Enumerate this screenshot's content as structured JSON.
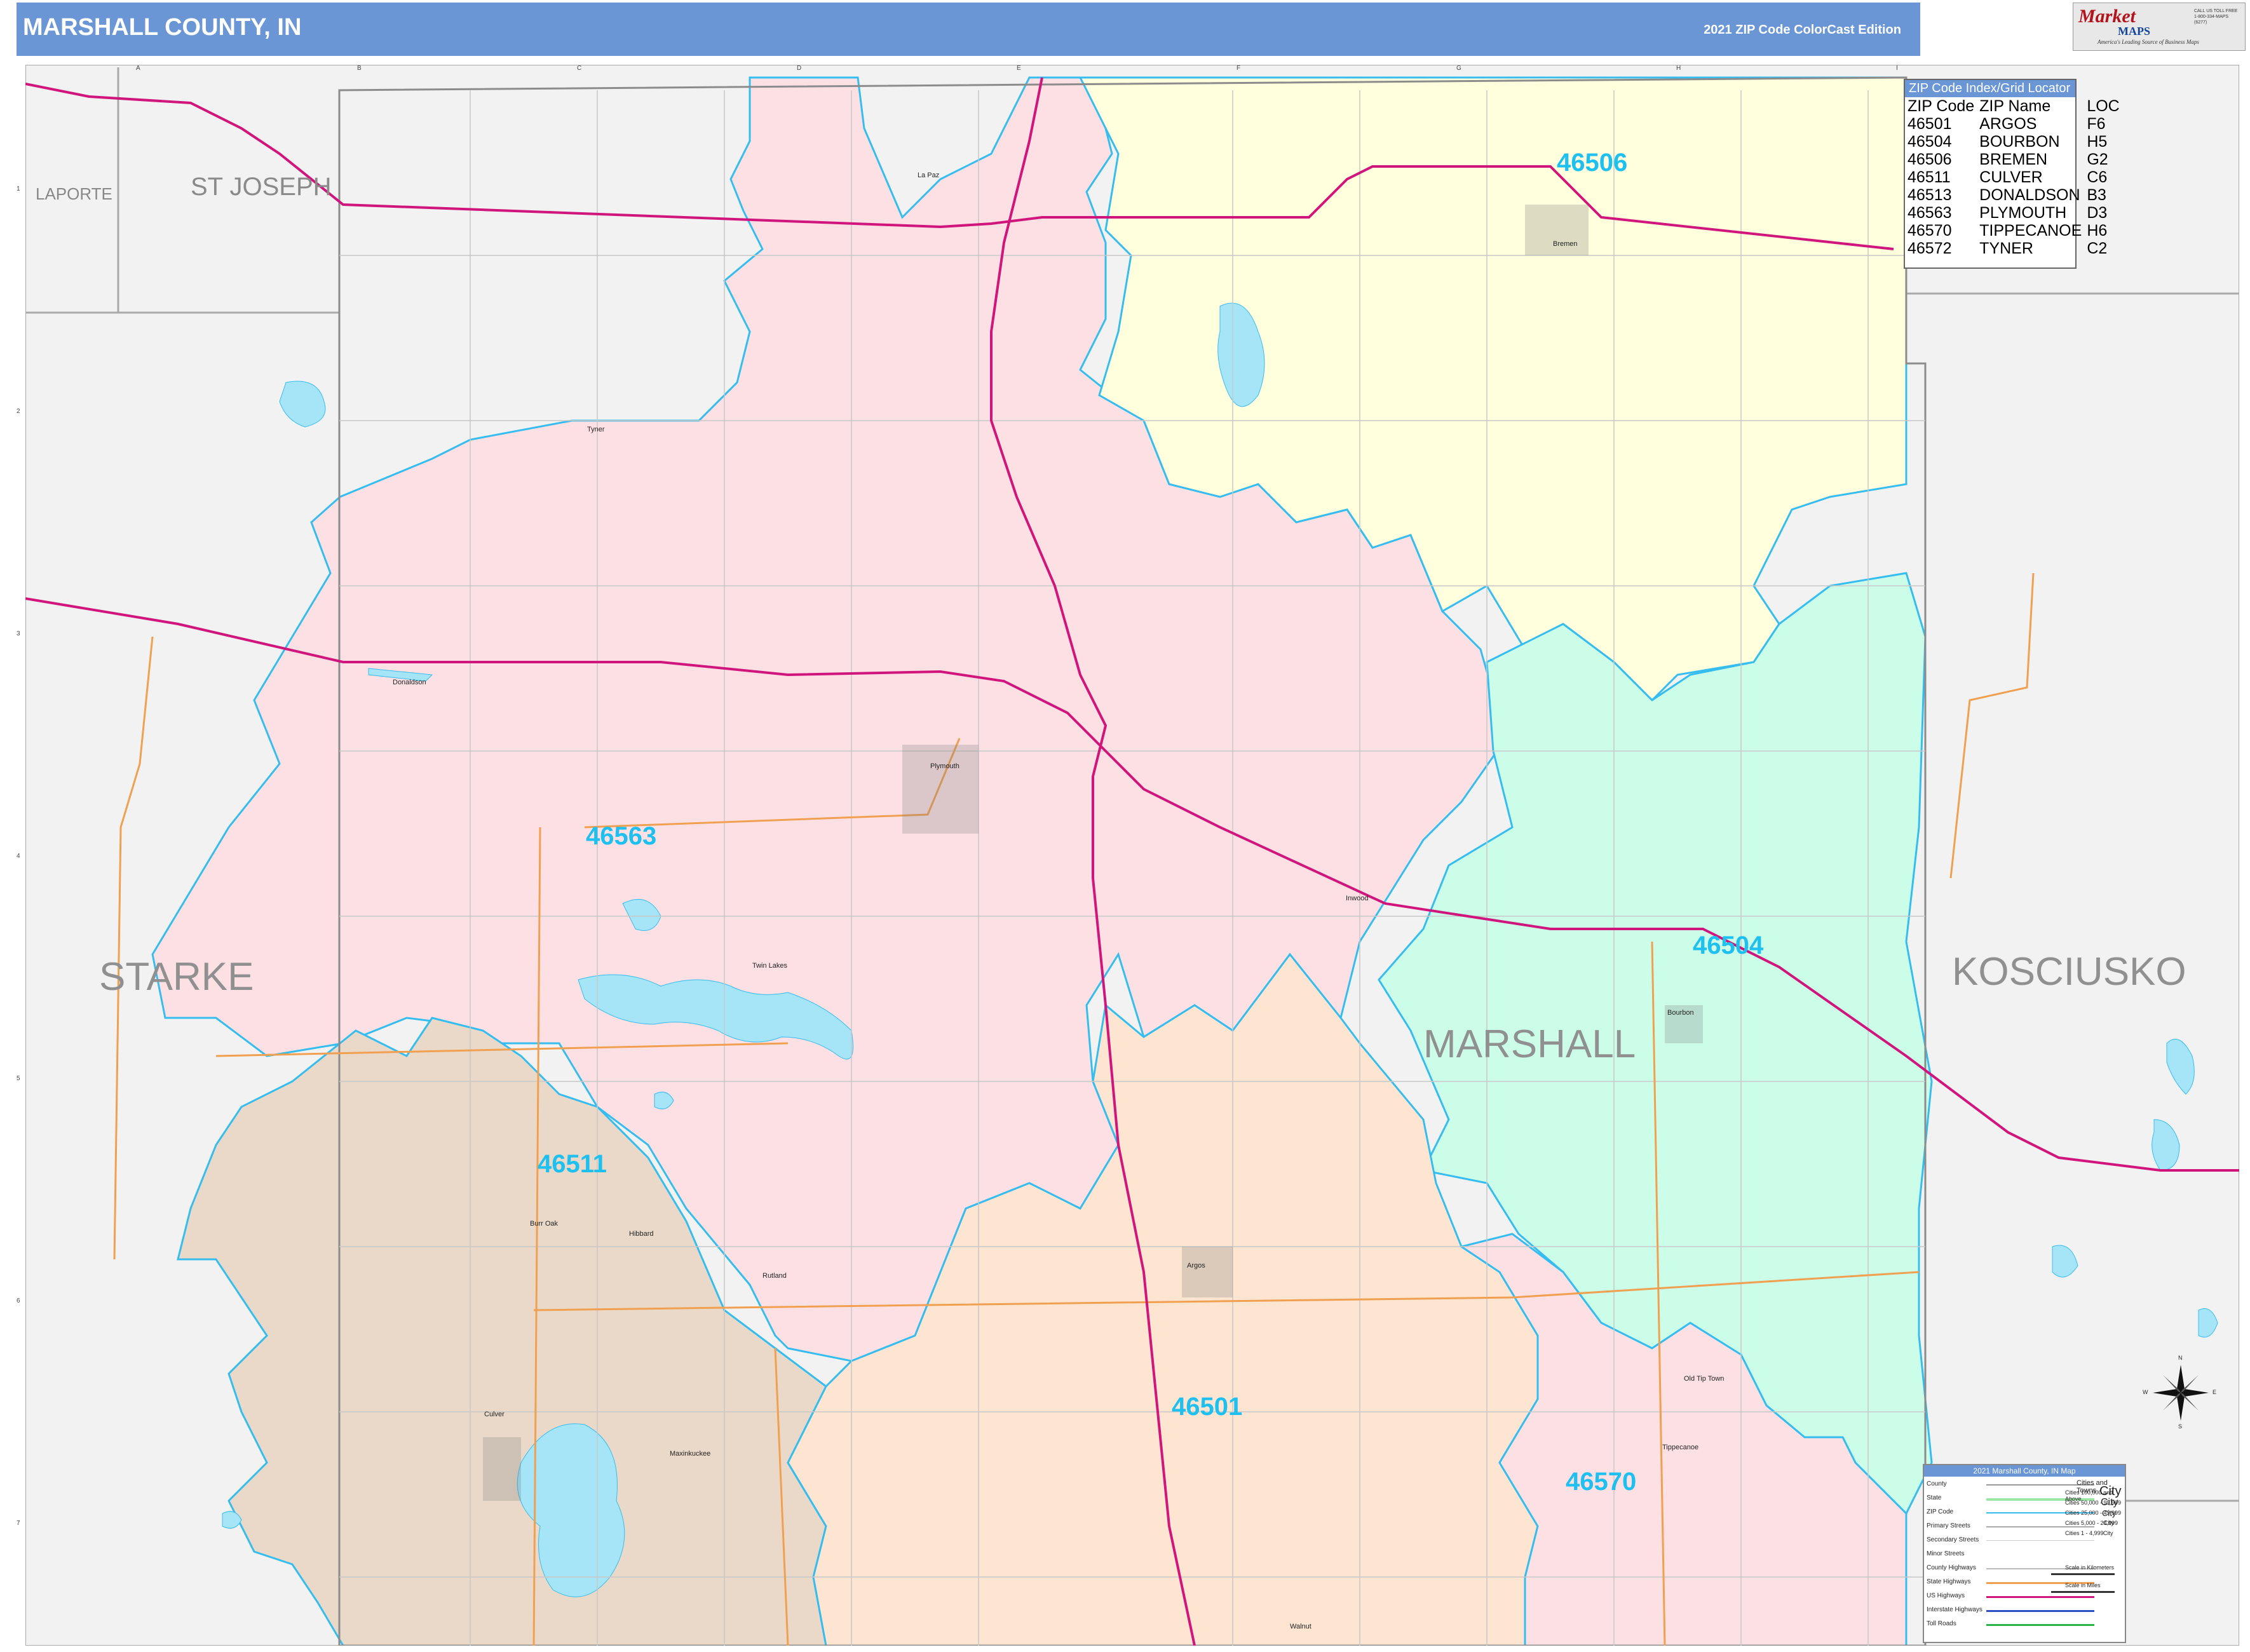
{
  "header": {
    "title": "MARSHALL COUNTY, IN",
    "edition": "2021 ZIP Code ColorCast Edition"
  },
  "logo": {
    "mark": "Market",
    "brand": "MAPS",
    "slogan": "America's Leading Source of Business Maps",
    "phone": "CALL US TOLL FREE 1-800-334-MAPS (6277)"
  },
  "zip_index": {
    "title": "ZIP Code Index/Grid Locator",
    "columns": [
      "ZIP Code",
      "ZIP Name",
      "LOC"
    ],
    "rows": [
      [
        "46501",
        "ARGOS",
        "F6"
      ],
      [
        "46504",
        "BOURBON",
        "H5"
      ],
      [
        "46506",
        "BREMEN",
        "G2"
      ],
      [
        "46511",
        "CULVER",
        "C6"
      ],
      [
        "46513",
        "DONALDSON",
        "B3"
      ],
      [
        "46563",
        "PLYMOUTH",
        "D3"
      ],
      [
        "46570",
        "TIPPECANOE",
        "H6"
      ],
      [
        "46572",
        "TYNER",
        "C2"
      ]
    ]
  },
  "zip_labels": {
    "z46506": "46506",
    "z46563": "46563",
    "z46504": "46504",
    "z46511": "46511",
    "z46501": "46501",
    "z46570": "46570"
  },
  "counties": {
    "starke": "STARKE",
    "marshall": "MARSHALL",
    "kosciusko": "KOSCIUSKO",
    "st_joseph": "ST JOSEPH",
    "laporte": "LAPORTE"
  },
  "towns": {
    "la_paz": "La Paz",
    "bremen": "Bremen",
    "tyner": "Tyner",
    "donaldson": "Donaldson",
    "plymouth": "Plymouth",
    "twin_lakes": "Twin Lakes",
    "inwood": "Inwood",
    "bourbon": "Bourbon",
    "burr_oak": "Burr Oak",
    "hibbard": "Hibbard",
    "rutland": "Rutland",
    "culver": "Culver",
    "maxinkuckee": "Maxinkuckee",
    "old_tip_town": "Old Tip Town",
    "tippecanoe": "Tippecanoe",
    "walnut": "Walnut",
    "argos": "Argos"
  },
  "grid": {
    "columns": [
      "A",
      "B",
      "C",
      "D",
      "E",
      "F",
      "G",
      "H",
      "I"
    ],
    "rows": [
      "1",
      "2",
      "3",
      "4",
      "5",
      "6",
      "7"
    ]
  },
  "map_legend": {
    "title": "2021 Marshall County, IN Map",
    "items": [
      "County",
      "State",
      "ZIP Code",
      "Primary Streets",
      "Secondary Streets",
      "Minor Streets",
      "County Highways",
      "State Highways",
      "US Highways",
      "Interstate Highways",
      "Toll Roads"
    ],
    "cities_title": "Cities and Towns",
    "city_sizes": [
      "Cities 100,000 and Above",
      "Cities 50,000 - 99,999",
      "Cities 25,000 - 49,999",
      "Cities 5,000 - 24,999",
      "Cities 1 - 4,999"
    ],
    "city_samples": [
      "City",
      "City",
      "City",
      "City",
      "City"
    ],
    "scale_km": "Scale in Kilometers",
    "scale_mi": "Scale in Miles"
  },
  "compass": {
    "n": "N",
    "s": "S",
    "e": "E",
    "w": "W"
  },
  "colors": {
    "header": "#6a96d6",
    "z46563": "#fde0e4",
    "z46506": "#fffedd",
    "z46504": "#ccfde8",
    "z46511": "#ead9c8",
    "z46501": "#fde5d1",
    "z46570": "#fde0e4",
    "zip_boundary": "#35bdf0",
    "us_highway": "#d0157c",
    "state_highway": "#f0a050",
    "water": "#a6e4f8",
    "outside": "#f2f2f2"
  }
}
